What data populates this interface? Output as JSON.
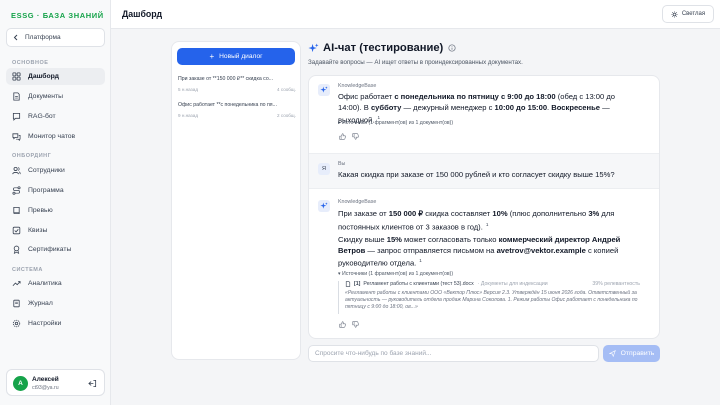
{
  "sidebar": {
    "brand": "ESSG · БАЗА ЗНАНИЙ",
    "platform_label": "Платформа",
    "sections": {
      "main": "ОСНОВНОЕ",
      "onboarding": "ОНБОРДИНГ",
      "system": "СИСТЕМА"
    },
    "items": {
      "dashboard": "Дашборд",
      "documents": "Документы",
      "ragbot": "RAG-бот",
      "monitor": "Монитор чатов",
      "staff": "Сотрудники",
      "program": "Программа",
      "preview": "Превью",
      "quizzes": "Квизы",
      "certificates": "Сертификаты",
      "analytics": "Аналитика",
      "journal": "Журнал",
      "settings": "Настройки"
    },
    "user": {
      "initial": "A",
      "name": "Алексей",
      "email": "ct93@ya.ru"
    }
  },
  "topbar": {
    "title": "Дашборд",
    "theme_label": "Светлая"
  },
  "dialogs": {
    "new_label": "Новый диалог",
    "items": [
      {
        "title": "При заказе от **150 000 ₽** скидка со...",
        "time": "5 н.назад",
        "count": "4 сообщ."
      },
      {
        "title": "Офис работает **с понедельника по пя...",
        "time": "9 н.назад",
        "count": "2 сообщ."
      }
    ]
  },
  "chat": {
    "title": "AI-чат (тестирование)",
    "subtitle": "Задавайте вопросы — AI ищет ответы в проиндексированных документах.",
    "input_placeholder": "Спросите что-нибудь по базе знаний...",
    "send_label": "Отправить",
    "messages": {
      "m1": {
        "sender": "KnowledgeBase",
        "p1": "Офис работает ",
        "b1": "с понедельника по пятницу с 9:00 до 18:00",
        "p2": " (обед с 13:00 до 14:00). В ",
        "b2": "субботу",
        "p3": " — дежурный менеджер с ",
        "b3": "10:00 до 15:00",
        "p4": ". ",
        "b4": "Воскресенье",
        "p5": " — выходной.",
        "sup": "1",
        "sources": "▸ Источники (1 фрагмент(ов) из 1 документ(ов))"
      },
      "m2": {
        "avatar": "Я",
        "sender": "Вы",
        "text": "Какая скидка при заказе от 150 000 рублей и кто согласует скидку выше 15%?"
      },
      "m3": {
        "sender": "KnowledgeBase",
        "p1": "При заказе от ",
        "b1": "150 000 ₽",
        "p2": " скидка составляет ",
        "b2": "10%",
        "p3": " (плюс дополнительно ",
        "b3": "3%",
        "p4": " для постоянных клиентов от 3 заказов в год).",
        "sup1": "1",
        "q1": "Скидку выше ",
        "qb1": "15%",
        "q2": " может согласовать только ",
        "qb2": "коммерческий директор Андрей Ветров",
        "q3": " — запрос отправляется письмом на ",
        "qb3": "avetrov@vektor.example",
        "q4": " с копией руководителю отдела.",
        "sup2": "1",
        "sources": "▾ Источники (1 фрагмент(ов) из 1 документ(ов))",
        "source": {
          "num": "[1]",
          "doc": "Регламент работы с клиентами (тест 53).docx",
          "tag": "· Документы для индексации",
          "relevance": "39% релевантность",
          "quote": "«Регламент работы с клиентами ООО «Вектор Плюс» Версия 2.3. Утверждён 15 июня 2026 года. Ответственный за актуальность — руководитель отдела продаж Марина Соколова. 1. Режим работы Офис работает с понедельника по пятницу с 9:00 до 18:00, ов...»"
        }
      }
    }
  },
  "colors": {
    "brand_green": "#16a34a",
    "accent_blue": "#2563eb",
    "send_disabled": "#a5bdf5"
  }
}
